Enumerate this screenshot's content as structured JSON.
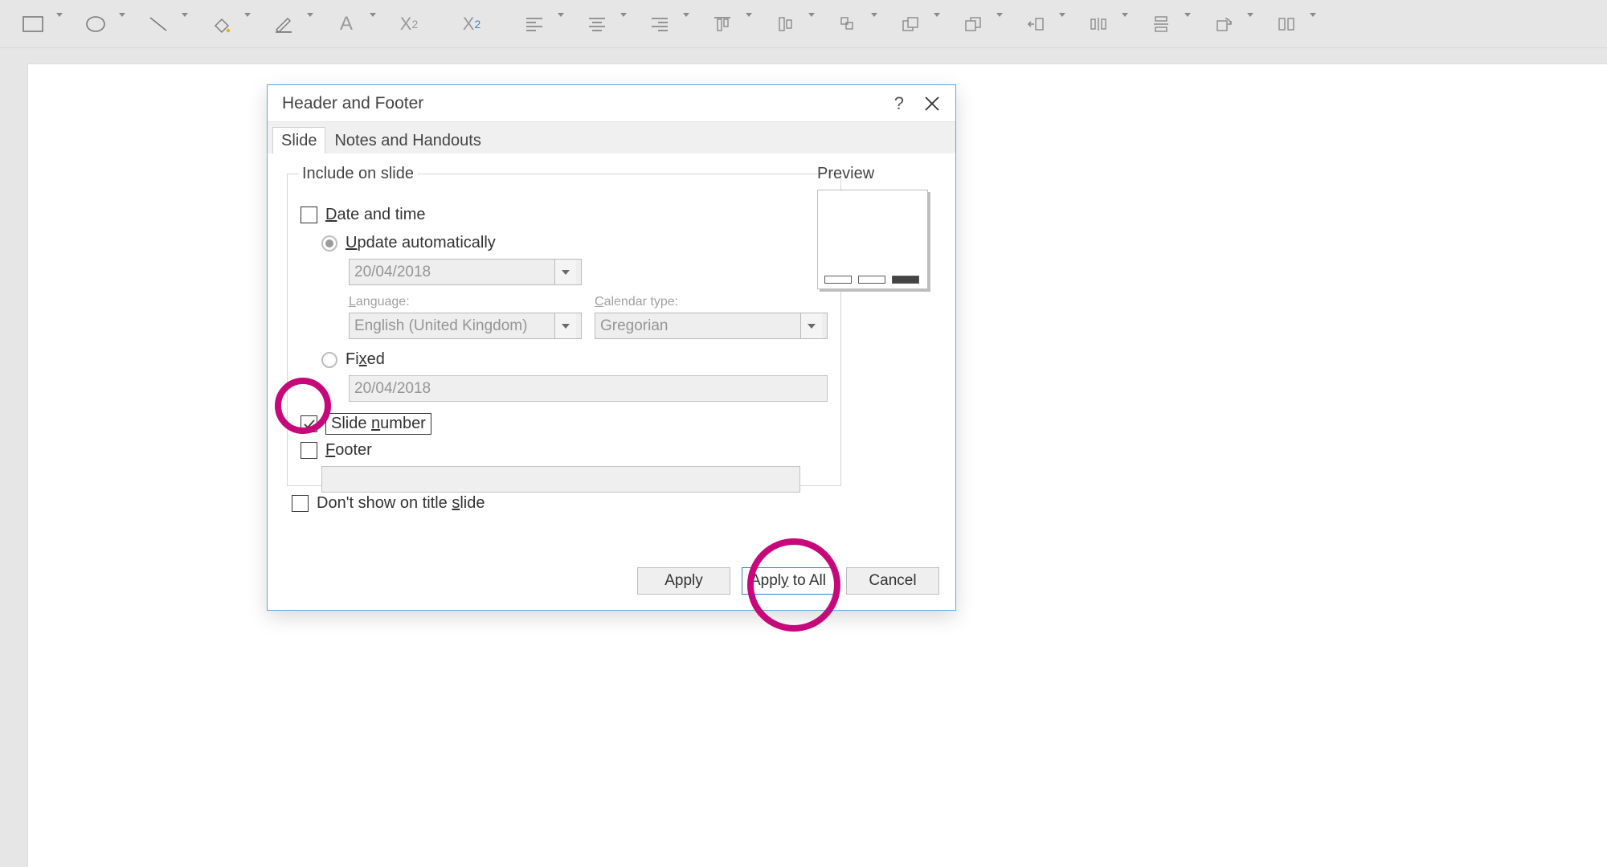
{
  "toolbar": {
    "items": [
      {
        "name": "rectangle-icon"
      },
      {
        "name": "oval-icon"
      },
      {
        "name": "line-icon"
      },
      {
        "name": "fill-icon"
      },
      {
        "name": "outline-icon"
      },
      {
        "name": "font-color-icon"
      },
      {
        "name": "subscript-icon"
      },
      {
        "name": "superscript-icon"
      },
      {
        "name": "align-left-icon"
      },
      {
        "name": "align-center-icon"
      },
      {
        "name": "align-right-icon"
      },
      {
        "name": "align-top-icon"
      },
      {
        "name": "align-middle-icon"
      },
      {
        "name": "align-bottom-icon"
      },
      {
        "name": "bring-forward-icon"
      },
      {
        "name": "send-backward-icon"
      },
      {
        "name": "right-to-left-icon"
      },
      {
        "name": "distribute-h-icon"
      },
      {
        "name": "distribute-v-icon"
      },
      {
        "name": "rotate-icon"
      },
      {
        "name": "equal-width-icon"
      }
    ]
  },
  "dialog": {
    "title": "Header and Footer",
    "tabs": {
      "slide": "Slide",
      "notes": "Notes and Handouts",
      "active": "slide"
    },
    "group_label": "Include on slide",
    "date_and_time": {
      "label": "Date and time",
      "checked": false
    },
    "update_auto": {
      "label": "Update automatically",
      "selected": true
    },
    "date_combo": "20/04/2018",
    "language_label": "Language:",
    "language_value": "English (United Kingdom)",
    "calendar_label": "Calendar type:",
    "calendar_value": "Gregorian",
    "fixed": {
      "label": "Fixed",
      "selected": false
    },
    "fixed_value": "20/04/2018",
    "slide_number": {
      "label": "Slide number",
      "checked": true
    },
    "footer": {
      "label": "Footer",
      "checked": false
    },
    "footer_value": "",
    "dont_show": {
      "label": "Don't show on title slide",
      "checked": false
    },
    "preview_label": "Preview",
    "buttons": {
      "apply": "Apply",
      "apply_all": "Apply to All",
      "cancel": "Cancel"
    }
  }
}
